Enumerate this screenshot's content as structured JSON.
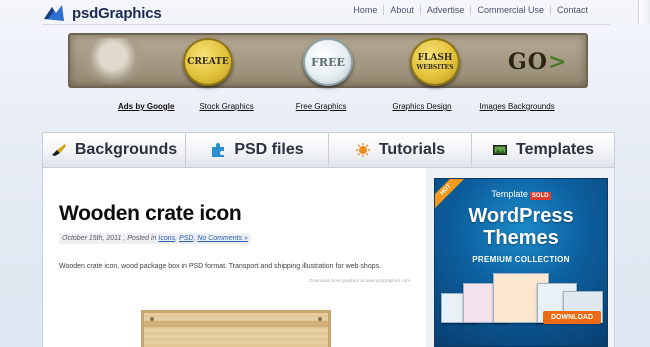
{
  "site": {
    "name": "psdGraphics"
  },
  "topnav": [
    "Home",
    "About",
    "Advertise",
    "Commercial Use",
    "Contact"
  ],
  "banner": {
    "badges": [
      {
        "label": "CREATE",
        "style": "yellow"
      },
      {
        "label": "FREE",
        "style": "white"
      },
      {
        "label": "FLASH",
        "sub": "WEBSITES",
        "style": "yellow"
      }
    ],
    "go_text": "GO",
    "go_arrow": ">"
  },
  "linkbar": {
    "ads": "Ads by Google",
    "links": [
      "Stock Graphics",
      "Free Graphics",
      "Graphics Design",
      "Images Backgrounds"
    ]
  },
  "tabs": [
    {
      "label": "Backgrounds",
      "icon": "brush-icon",
      "color": "#d6a419"
    },
    {
      "label": "PSD files",
      "icon": "puzzle-icon",
      "color": "#2a8fd0"
    },
    {
      "label": "Tutorials",
      "icon": "sun-icon",
      "color": "#f08a1c"
    },
    {
      "label": "Templates",
      "icon": "image-icon",
      "color": "#3d7a32"
    }
  ],
  "post": {
    "title": "Wooden crate icon",
    "date": "October 15th, 2011",
    "posted_in_prefix": ", Posted in",
    "category1": "Icons",
    "category2": "PSD",
    "comments": "No Comments »",
    "excerpt": "Wooden crate icon, wood package box in PSD format. Transport and shipping illustration for web shops.",
    "credit": "Download more graphics at www.psdgraphics.com"
  },
  "ad": {
    "hot": "HOT",
    "brand": "Template",
    "brand_badge": "SOLD",
    "headline1": "WordPress",
    "headline2": "Themes",
    "sub": "PREMIUM COLLECTION",
    "download": "DOWNLOAD"
  },
  "colors": {
    "accent_blue": "#2a5db0",
    "ad_blue": "#0d5f9e",
    "download_orange": "#ea6a16"
  }
}
